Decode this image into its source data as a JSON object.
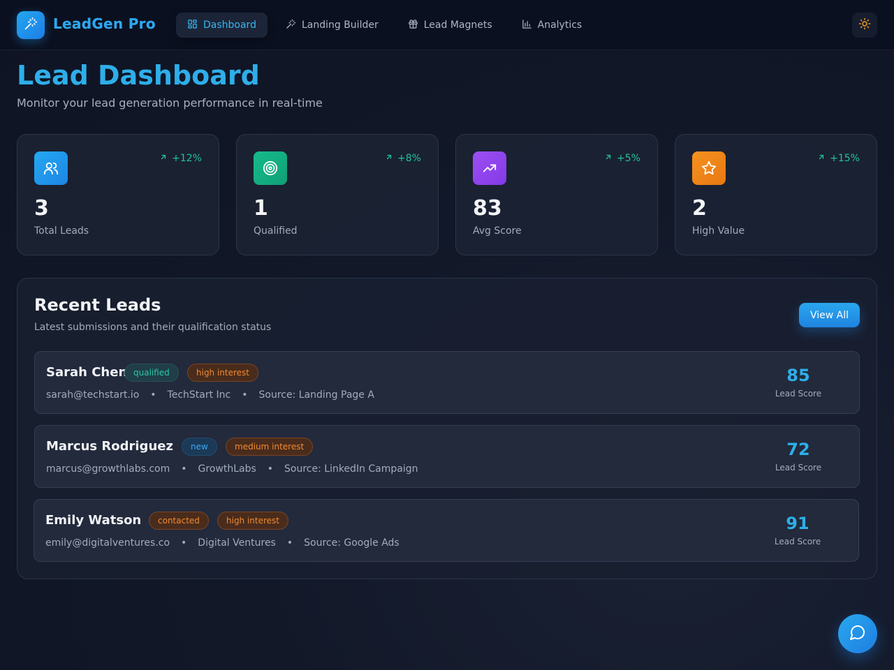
{
  "app": {
    "title": "LeadGen Pro"
  },
  "nav": {
    "items": [
      {
        "label": "Dashboard",
        "icon": "layout-grid-icon",
        "active": true
      },
      {
        "label": "Landing Builder",
        "icon": "magic-wand-icon",
        "active": false
      },
      {
        "label": "Lead Magnets",
        "icon": "gift-icon",
        "active": false
      },
      {
        "label": "Analytics",
        "icon": "bar-chart-icon",
        "active": false
      }
    ]
  },
  "header": {
    "theme_icon": "sun-icon"
  },
  "page": {
    "title": "Lead Dashboard",
    "subtitle": "Monitor your lead generation performance in real-time"
  },
  "stats": [
    {
      "value": "3",
      "label": "Total Leads",
      "change": "+12%",
      "icon": "users-icon",
      "color": "#1e9ef0"
    },
    {
      "value": "1",
      "label": "Qualified",
      "change": "+8%",
      "icon": "target-icon",
      "color": "#12b384"
    },
    {
      "value": "83",
      "label": "Avg Score",
      "change": "+5%",
      "icon": "trending-up-icon",
      "color": "#9146ee"
    },
    {
      "value": "2",
      "label": "High Value",
      "change": "+15%",
      "icon": "star-icon",
      "color": "#f0861a"
    }
  ],
  "recent": {
    "title": "Recent Leads",
    "subtitle": "Latest submissions and their qualification status",
    "view_all": "View All",
    "leads": [
      {
        "name": "Sarah Chen",
        "status": "qualified",
        "interest": "high interest",
        "email": "sarah@techstart.io",
        "company": "TechStart Inc",
        "source": "Source: Landing Page A",
        "score": "85",
        "score_label": "Lead Score"
      },
      {
        "name": "Marcus Rodriguez",
        "status": "new",
        "interest": "medium interest",
        "email": "marcus@growthlabs.com",
        "company": "GrowthLabs",
        "source": "Source: LinkedIn Campaign",
        "score": "72",
        "score_label": "Lead Score"
      },
      {
        "name": "Emily Watson",
        "status": "contacted",
        "interest": "high interest",
        "email": "emily@digitalventures.co",
        "company": "Digital Ventures",
        "source": "Source: Google Ads",
        "score": "91",
        "score_label": "Lead Score"
      }
    ]
  },
  "chat": {
    "icon": "chat-bubble-icon"
  },
  "colors": {
    "accent": "#2eaee9",
    "positive": "#22c39a",
    "warning": "#f08a30"
  }
}
